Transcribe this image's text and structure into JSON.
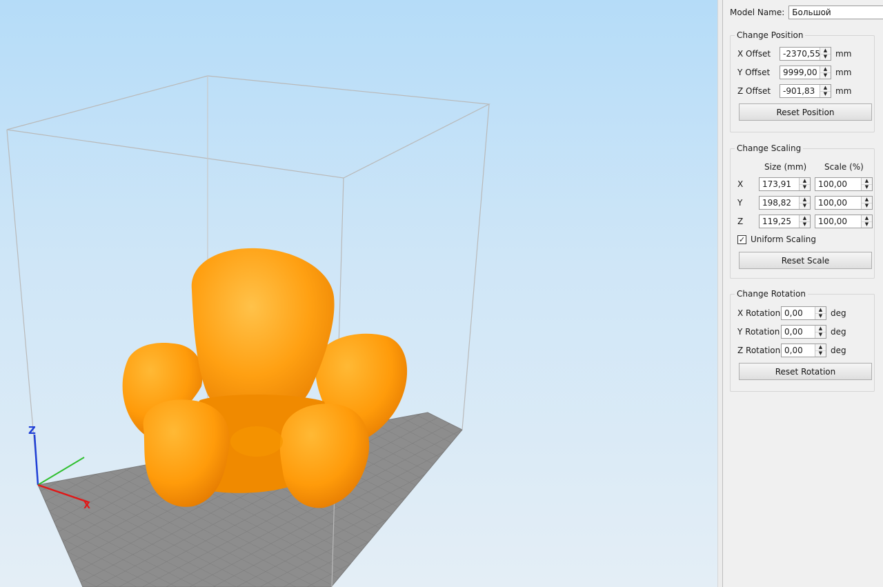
{
  "model": {
    "name_label": "Model Name:",
    "name_value": "Большой"
  },
  "position": {
    "title": "Change Position",
    "rows": [
      {
        "label": "X Offset",
        "value": "-2370,55",
        "unit": "mm"
      },
      {
        "label": "Y Offset",
        "value": "9999,00",
        "unit": "mm"
      },
      {
        "label": "Z Offset",
        "value": "-901,83",
        "unit": "mm"
      }
    ],
    "reset_label": "Reset Position"
  },
  "scaling": {
    "title": "Change Scaling",
    "size_header": "Size (mm)",
    "scale_header": "Scale (%)",
    "rows": [
      {
        "axis": "X",
        "size": "173,91",
        "scale": "100,00"
      },
      {
        "axis": "Y",
        "size": "198,82",
        "scale": "100,00"
      },
      {
        "axis": "Z",
        "size": "119,25",
        "scale": "100,00"
      }
    ],
    "uniform_label": "Uniform Scaling",
    "uniform_checked": true,
    "checkmark": "✓",
    "reset_label": "Reset Scale"
  },
  "rotation": {
    "title": "Change Rotation",
    "rows": [
      {
        "label": "X Rotation",
        "value": "0,00",
        "unit": "deg"
      },
      {
        "label": "Y Rotation",
        "value": "0,00",
        "unit": "deg"
      },
      {
        "label": "Z Rotation",
        "value": "0,00",
        "unit": "deg"
      }
    ],
    "reset_label": "Reset Rotation"
  },
  "viewport": {
    "axis_labels": {
      "x": "X",
      "y": "",
      "z": "Z"
    },
    "model_color": "#ff9f0f",
    "bed_color": "#8c8c8c",
    "colors": {
      "x_axis": "#e01818",
      "y_axis": "#2fbf2f",
      "z_axis": "#1f3fd6"
    }
  },
  "icons": {
    "spin_up": "▲",
    "spin_down": "▼"
  }
}
